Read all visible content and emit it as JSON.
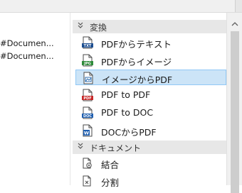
{
  "left_files": [
    "#Documen...",
    "#Documen..."
  ],
  "sections": {
    "convert": {
      "label": "変換"
    },
    "document": {
      "label": "ドキュメント"
    }
  },
  "convert_items": [
    {
      "label": "PDFからテキスト",
      "icon": "txt-file-icon",
      "badge": "TXT"
    },
    {
      "label": "PDFからイメージ",
      "icon": "jpg-file-icon",
      "badge": "JPG"
    },
    {
      "label": "イメージからPDF",
      "icon": "image-file-icon",
      "selected": true
    },
    {
      "label": "PDF to PDF",
      "icon": "pdf-file-icon",
      "badge": "PDF"
    },
    {
      "label": "PDF to DOC",
      "icon": "doc-file-icon",
      "badge": "DOC"
    },
    {
      "label": "DOCからPDF",
      "icon": "word-file-icon",
      "badge": "W"
    }
  ],
  "document_items": [
    {
      "label": "結合",
      "icon": "merge-icon"
    },
    {
      "label": "分割",
      "icon": "split-icon"
    }
  ],
  "colors": {
    "selection_bg": "#cce4f7",
    "selection_border": "#90c8f6",
    "section_header_bg": "#e7e7e7",
    "txt_badge": "#1e4f91",
    "jpg_badge": "#2e8b3a",
    "pdf_badge": "#c62828",
    "doc_badge": "#1f5fb0"
  }
}
